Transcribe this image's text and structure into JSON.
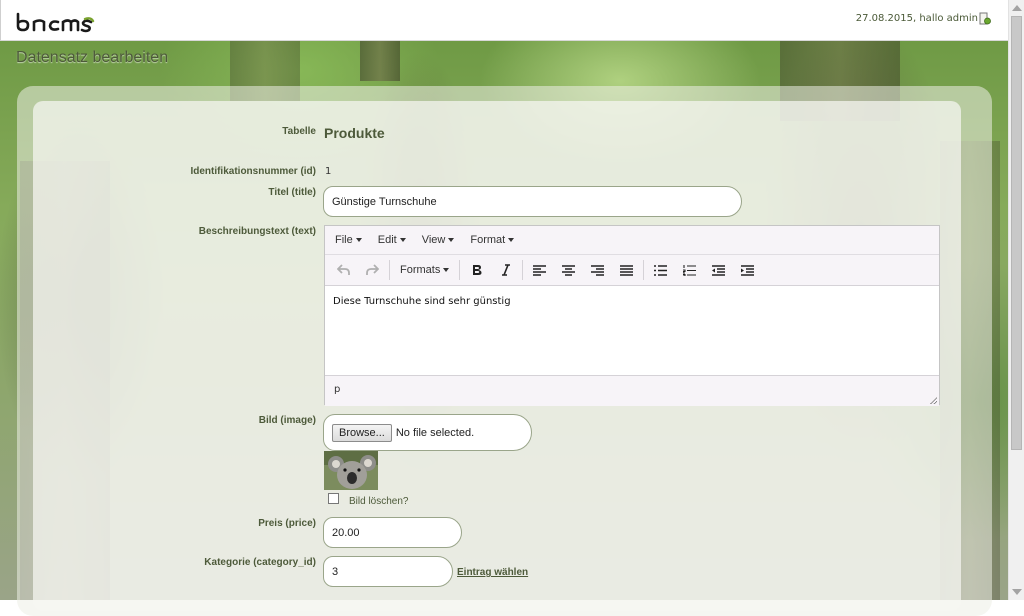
{
  "app": {
    "logo_text": "bncms"
  },
  "header": {
    "status": "27.08.2015, hallo admin"
  },
  "page": {
    "title": "Datensatz bearbeiten"
  },
  "form": {
    "table_label": "Tabelle",
    "table_name": "Produkte",
    "id_label": "Identifikationsnummer (id)",
    "id_value": "1",
    "title_label": "Titel (title)",
    "title_value": "Günstige Turnschuhe",
    "desc_label": "Beschreibungstext (text)",
    "image_label": "Bild (image)",
    "browse_label": "Browse...",
    "file_status": "No file selected.",
    "delete_image_label": "Bild löschen?",
    "price_label": "Preis (price)",
    "price_value": "20.00",
    "category_label": "Kategorie (category_id)",
    "category_value": "3",
    "choose_entry_link": "Eintrag wählen"
  },
  "editor": {
    "menu": [
      "File",
      "Edit",
      "View",
      "Format"
    ],
    "formats_label": "Formats",
    "content": "Diese Turnschuhe sind sehr günstig",
    "status_path": "p"
  },
  "icons": {
    "logout": "logout-icon",
    "toolbar": [
      "undo-icon",
      "redo-icon",
      "bold-icon",
      "italic-icon",
      "align-left-icon",
      "align-center-icon",
      "align-right-icon",
      "align-justify-icon",
      "bullet-list-icon",
      "numbered-list-icon",
      "outdent-icon",
      "indent-icon"
    ]
  },
  "colors": {
    "label": "#4d5a3a",
    "accent": "#4b5a38"
  }
}
